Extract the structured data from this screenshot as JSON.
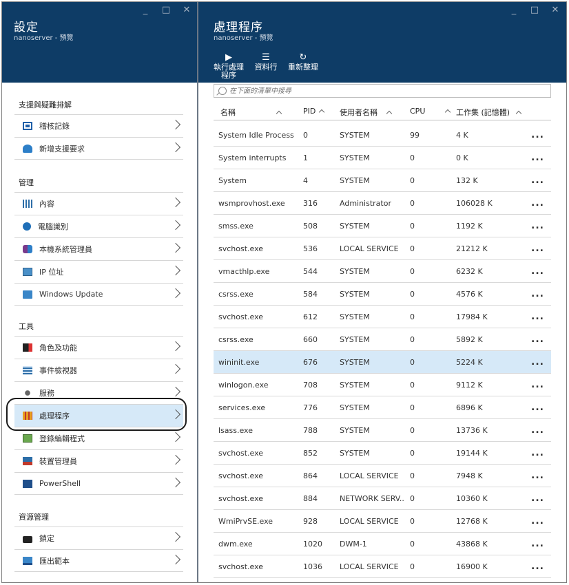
{
  "left_blade": {
    "title": "設定",
    "subtitle": "nanoserver - 預覽",
    "sections": [
      {
        "heading": "支援與疑難排解",
        "items": [
          {
            "label": "稽核記錄",
            "icon": "audit-log-icon"
          },
          {
            "label": "新增支援要求",
            "icon": "support-request-icon"
          }
        ]
      },
      {
        "heading": "管理",
        "items": [
          {
            "label": "內容",
            "icon": "properties-icon"
          },
          {
            "label": "電腦識別",
            "icon": "info-icon"
          },
          {
            "label": "本機系統管理員",
            "icon": "local-admin-icon"
          },
          {
            "label": "IP 位址",
            "icon": "ip-address-icon"
          },
          {
            "label": "Windows Update",
            "icon": "windows-update-icon"
          }
        ]
      },
      {
        "heading": "工具",
        "items": [
          {
            "label": "角色及功能",
            "icon": "roles-features-icon"
          },
          {
            "label": "事件檢視器",
            "icon": "event-viewer-icon"
          },
          {
            "label": "服務",
            "icon": "services-icon"
          },
          {
            "label": "處理程序",
            "icon": "processes-icon"
          },
          {
            "label": "登錄編輯程式",
            "icon": "registry-editor-icon"
          },
          {
            "label": "裝置管理員",
            "icon": "device-manager-icon"
          },
          {
            "label": "PowerShell",
            "icon": "powershell-icon"
          }
        ]
      },
      {
        "heading": "資源管理",
        "items": [
          {
            "label": "鎖定",
            "icon": "lock-icon"
          },
          {
            "label": "匯出範本",
            "icon": "export-template-icon"
          }
        ]
      }
    ]
  },
  "right_blade": {
    "title": "處理程序",
    "subtitle": "nanoserver - 預覽",
    "commands": [
      {
        "label": "執行處理程序",
        "icon": "play-icon"
      },
      {
        "label": "資料行",
        "icon": "columns-icon"
      },
      {
        "label": "重新整理",
        "icon": "refresh-icon"
      }
    ],
    "search_placeholder": "在下面的清單中搜尋",
    "columns": [
      "名稱",
      "PID",
      "使用者名稱",
      "CPU",
      "工作集 (記憶體)"
    ],
    "rows": [
      [
        "System Idle Process",
        "0",
        "SYSTEM",
        "99",
        "4 K"
      ],
      [
        "System interrupts",
        "1",
        "SYSTEM",
        "0",
        "0 K"
      ],
      [
        "System",
        "4",
        "SYSTEM",
        "0",
        "132 K"
      ],
      [
        "wsmprovhost.exe",
        "316",
        "Administrator",
        "0",
        "106028 K"
      ],
      [
        "smss.exe",
        "508",
        "SYSTEM",
        "0",
        "1192 K"
      ],
      [
        "svchost.exe",
        "536",
        "LOCAL SERVICE",
        "0",
        "21212 K"
      ],
      [
        "vmacthlp.exe",
        "544",
        "SYSTEM",
        "0",
        "6232 K"
      ],
      [
        "csrss.exe",
        "584",
        "SYSTEM",
        "0",
        "4576 K"
      ],
      [
        "svchost.exe",
        "612",
        "SYSTEM",
        "0",
        "17984 K"
      ],
      [
        "csrss.exe",
        "660",
        "SYSTEM",
        "0",
        "5892 K"
      ],
      [
        "wininit.exe",
        "676",
        "SYSTEM",
        "0",
        "5224 K"
      ],
      [
        "winlogon.exe",
        "708",
        "SYSTEM",
        "0",
        "9112 K"
      ],
      [
        "services.exe",
        "776",
        "SYSTEM",
        "0",
        "6896 K"
      ],
      [
        "lsass.exe",
        "788",
        "SYSTEM",
        "0",
        "13736 K"
      ],
      [
        "svchost.exe",
        "852",
        "SYSTEM",
        "0",
        "19144 K"
      ],
      [
        "svchost.exe",
        "864",
        "LOCAL SERVICE",
        "0",
        "7948 K"
      ],
      [
        "svchost.exe",
        "884",
        "NETWORK SERV...",
        "0",
        "10360 K"
      ],
      [
        "WmiPrvSE.exe",
        "928",
        "LOCAL SERVICE",
        "0",
        "12768 K"
      ],
      [
        "dwm.exe",
        "1020",
        "DWM-1",
        "0",
        "43868 K"
      ],
      [
        "svchost.exe",
        "1036",
        "LOCAL SERVICE",
        "0",
        "16900 K"
      ]
    ],
    "selected_row_index": 10,
    "row_more_label": "..."
  },
  "window_controls": {
    "minimize": "_",
    "maximize": "□",
    "close": "✕"
  },
  "colors": {
    "header_bg": "#0e3c66",
    "selected_bg": "#d6e9f8"
  }
}
